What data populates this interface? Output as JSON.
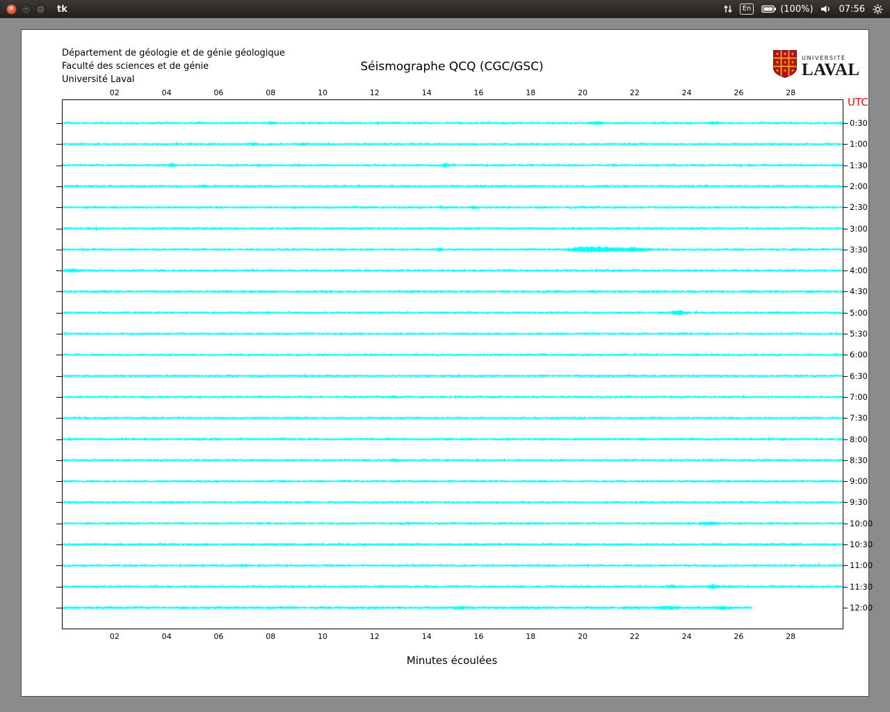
{
  "taskbar": {
    "title": "tk",
    "keyboard": "En",
    "battery": "(100%)",
    "time": "07:56"
  },
  "header": {
    "dept_lines": [
      "Département de géologie et de génie géologique",
      "Faculté des sciences et de génie",
      "Université Laval"
    ],
    "title": "Séismographe QCQ (CGC/GSC)",
    "logo": {
      "line1": "UNIVERSITÉ",
      "line2": "LAVAL"
    }
  },
  "chart_data": {
    "type": "line",
    "title": "Séismographe QCQ (CGC/GSC)",
    "xlabel": "Minutes écoulées",
    "right_axis_label": "UTC",
    "xlim": [
      0,
      30
    ],
    "x_ticks": [
      "02",
      "04",
      "06",
      "08",
      "10",
      "12",
      "14",
      "16",
      "18",
      "20",
      "22",
      "24",
      "26",
      "28"
    ],
    "trace_color": "#00ffff",
    "traces": [
      {
        "utc": "0:30",
        "end": 30,
        "noise": 1.0,
        "events": [
          [
            8.0,
            1.5,
            0.2
          ],
          [
            20.5,
            1.5,
            0.5
          ],
          [
            25.0,
            1.2,
            0.3
          ]
        ]
      },
      {
        "utc": "1:00",
        "end": 30,
        "noise": 1.0,
        "events": [
          [
            7.3,
            1.2,
            0.2
          ],
          [
            9.3,
            1.4,
            0.2
          ]
        ]
      },
      {
        "utc": "1:30",
        "end": 30,
        "noise": 1.0,
        "events": [
          [
            4.2,
            2.5,
            0.2
          ],
          [
            14.7,
            3.5,
            0.12
          ]
        ]
      },
      {
        "utc": "2:00",
        "end": 30,
        "noise": 1.0,
        "events": [
          [
            5.4,
            1.2,
            0.2
          ]
        ]
      },
      {
        "utc": "2:30",
        "end": 30,
        "noise": 1.0,
        "events": [
          [
            15.8,
            1.5,
            0.15
          ]
        ]
      },
      {
        "utc": "3:00",
        "end": 30,
        "noise": 1.0,
        "events": []
      },
      {
        "utc": "3:30",
        "end": 30,
        "noise": 1.0,
        "events": [
          [
            14.5,
            1.8,
            0.15
          ],
          [
            19.8,
            2.0,
            0.6
          ],
          [
            20.6,
            3.8,
            1.1
          ],
          [
            21.9,
            2.8,
            0.9
          ]
        ]
      },
      {
        "utc": "4:00",
        "end": 30,
        "noise": 1.0,
        "events": [
          [
            0.35,
            2.2,
            0.35
          ]
        ]
      },
      {
        "utc": "4:30",
        "end": 30,
        "noise": 1.1,
        "events": []
      },
      {
        "utc": "5:00",
        "end": 30,
        "noise": 1.0,
        "events": [
          [
            23.7,
            3.2,
            0.45
          ]
        ]
      },
      {
        "utc": "5:30",
        "end": 30,
        "noise": 1.0,
        "events": []
      },
      {
        "utc": "6:00",
        "end": 30,
        "noise": 1.0,
        "events": []
      },
      {
        "utc": "6:30",
        "end": 30,
        "noise": 1.0,
        "events": []
      },
      {
        "utc": "7:00",
        "end": 30,
        "noise": 1.0,
        "events": [
          [
            12.7,
            1.2,
            0.15
          ]
        ]
      },
      {
        "utc": "7:30",
        "end": 30,
        "noise": 1.0,
        "events": []
      },
      {
        "utc": "8:00",
        "end": 30,
        "noise": 1.05,
        "events": []
      },
      {
        "utc": "8:30",
        "end": 30,
        "noise": 1.0,
        "events": [
          [
            12.8,
            1.3,
            0.2
          ]
        ]
      },
      {
        "utc": "9:00",
        "end": 30,
        "noise": 1.0,
        "events": []
      },
      {
        "utc": "9:30",
        "end": 30,
        "noise": 1.0,
        "events": []
      },
      {
        "utc": "10:00",
        "end": 30,
        "noise": 1.0,
        "events": [
          [
            24.9,
            1.8,
            0.5
          ]
        ]
      },
      {
        "utc": "10:30",
        "end": 30,
        "noise": 1.1,
        "events": []
      },
      {
        "utc": "11:00",
        "end": 30,
        "noise": 1.0,
        "events": [
          [
            7.0,
            1.3,
            0.2
          ]
        ]
      },
      {
        "utc": "11:30",
        "end": 30,
        "noise": 1.0,
        "events": [
          [
            23.4,
            2.6,
            0.25
          ],
          [
            25.0,
            3.0,
            0.3
          ]
        ]
      },
      {
        "utc": "12:00",
        "end": 26.5,
        "noise": 1.1,
        "events": [
          [
            15.2,
            1.3,
            0.3
          ],
          [
            23.2,
            1.4,
            0.6
          ],
          [
            25.3,
            1.5,
            0.5
          ]
        ]
      }
    ]
  }
}
